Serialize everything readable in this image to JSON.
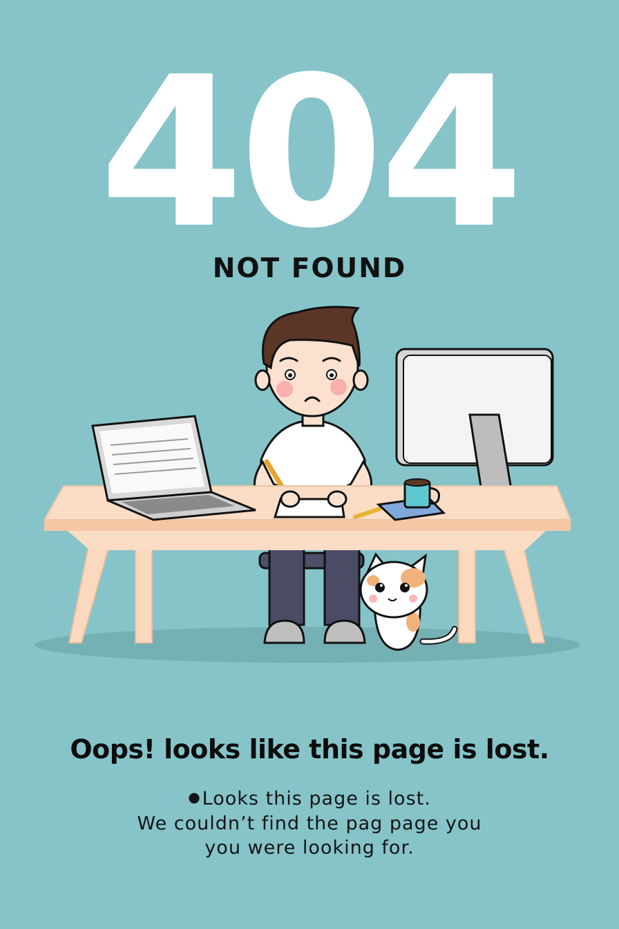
{
  "error": {
    "code": "404",
    "title": "NOT FOUND"
  },
  "message": {
    "headline": "Oops! looks like this page is lost.",
    "line1": "Looks this page is lost.",
    "line2": "We couldn’t find the pag page you",
    "line3": "you were looking for."
  },
  "colors": {
    "background": "#86c4c9",
    "text_dark": "#111111",
    "code_text": "#ffffff",
    "desk_top": "#fbdcc4",
    "monitor": "#f4f4f4",
    "mug": "#5ec8d0"
  }
}
